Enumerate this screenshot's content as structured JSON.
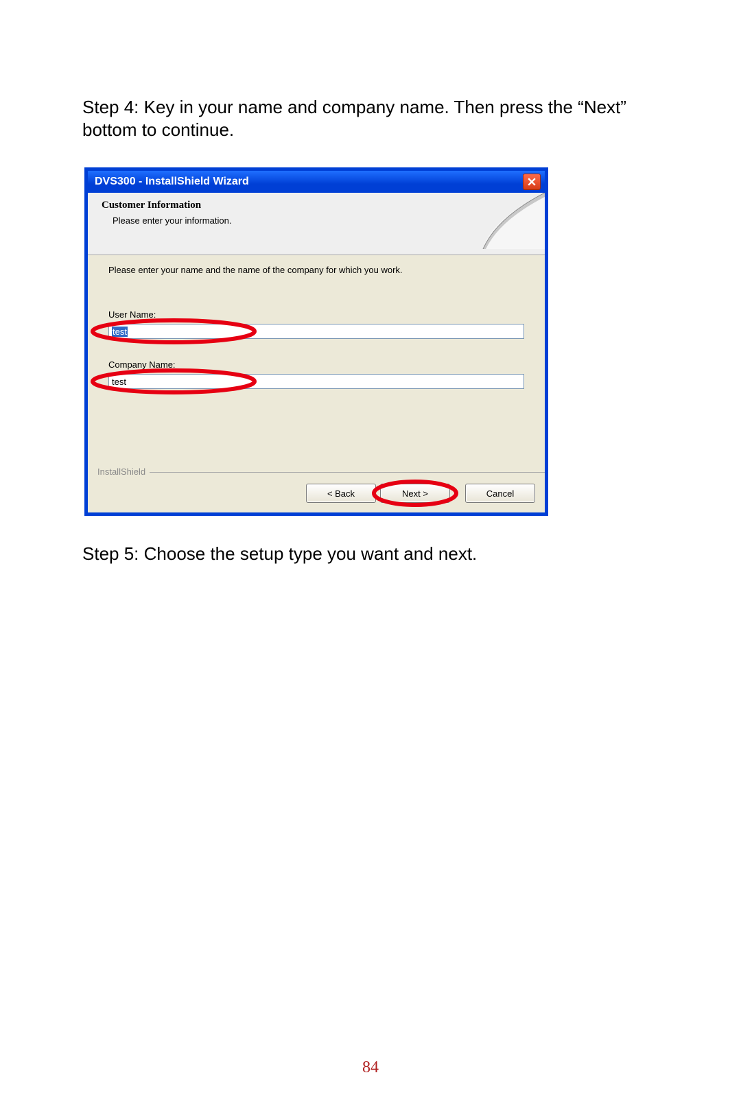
{
  "step4_text": "Step 4: Key in your name and company name. Then press the “Next” bottom to continue.",
  "step5_text": "Step 5: Choose the setup type you want and next.",
  "page_number": "84",
  "dialog": {
    "title": "DVS300 - InstallShield Wizard",
    "header_title": "Customer Information",
    "header_sub": "Please enter your information.",
    "instruction": "Please enter your name and the name of the company for which you work.",
    "user_name_label": "User Name:",
    "user_name_value": "test",
    "company_name_label": "Company Name:",
    "company_name_value": "test",
    "footer_label": "InstallShield",
    "back_button": "< Back",
    "next_button": "Next >",
    "cancel_button": "Cancel"
  },
  "annotation_color": "#e60012"
}
